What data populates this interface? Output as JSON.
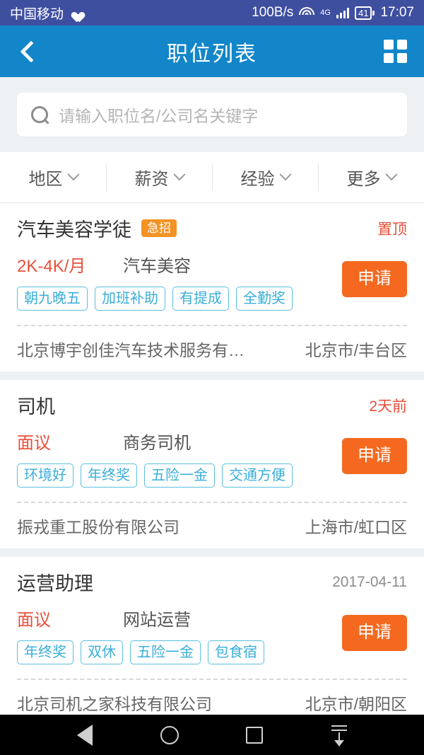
{
  "status_bar": {
    "carrier": "中国移动",
    "carrier_icon": "heart-pulse-icon",
    "network_speed": "100B/s",
    "wifi_icon": "wifi-icon",
    "network_type": "4G",
    "signal_icon": "signal-bars-icon",
    "battery_level": "41",
    "time": "17:07"
  },
  "header": {
    "back_icon": "back-chevron-icon",
    "title": "职位列表",
    "grid_icon": "grid-menu-icon"
  },
  "search": {
    "icon": "search-icon",
    "placeholder": "请输入职位名/公司名关键字",
    "value": ""
  },
  "filters": [
    {
      "label": "地区",
      "icon": "chevron-down-icon"
    },
    {
      "label": "薪资",
      "icon": "chevron-down-icon"
    },
    {
      "label": "经验",
      "icon": "chevron-down-icon"
    },
    {
      "label": "更多",
      "icon": "chevron-down-icon"
    }
  ],
  "jobs": [
    {
      "title": "汽车美容学徒",
      "badge": "急招",
      "meta": "置顶",
      "meta_style": "hot",
      "salary": "2K-4K/月",
      "category": "汽车美容",
      "tags": [
        "朝九晚五",
        "加班补助",
        "有提成",
        "全勤奖"
      ],
      "apply_label": "申请",
      "company": "北京博宇创佳汽车技术服务有…",
      "location": "北京市/丰台区"
    },
    {
      "title": "司机",
      "badge": "",
      "meta": "2天前",
      "meta_style": "hot",
      "salary": "面议",
      "category": "商务司机",
      "tags": [
        "环境好",
        "年终奖",
        "五险一金",
        "交通方便"
      ],
      "apply_label": "申请",
      "company": "振戎重工股份有限公司",
      "location": "上海市/虹口区"
    },
    {
      "title": "运营助理",
      "badge": "",
      "meta": "2017-04-11",
      "meta_style": "gray",
      "salary": "面议",
      "category": "网站运营",
      "tags": [
        "年终奖",
        "双休",
        "五险一金",
        "包食宿"
      ],
      "apply_label": "申请",
      "company": "北京司机之家科技有限公司",
      "location": "北京市/朝阳区"
    }
  ],
  "nav_bar": {
    "back_icon": "android-back-icon",
    "home_icon": "android-home-icon",
    "recents_icon": "android-recents-icon",
    "hide_icon": "hide-keyboard-icon"
  },
  "colors": {
    "status_bar_bg": "#3f4fa0",
    "header_bg": "#1286c9",
    "accent_orange": "#f4691f",
    "badge_orange": "#f39325",
    "salary_red": "#e8503a",
    "tag_blue": "#3aaed8",
    "page_bg": "#eef1f4"
  }
}
